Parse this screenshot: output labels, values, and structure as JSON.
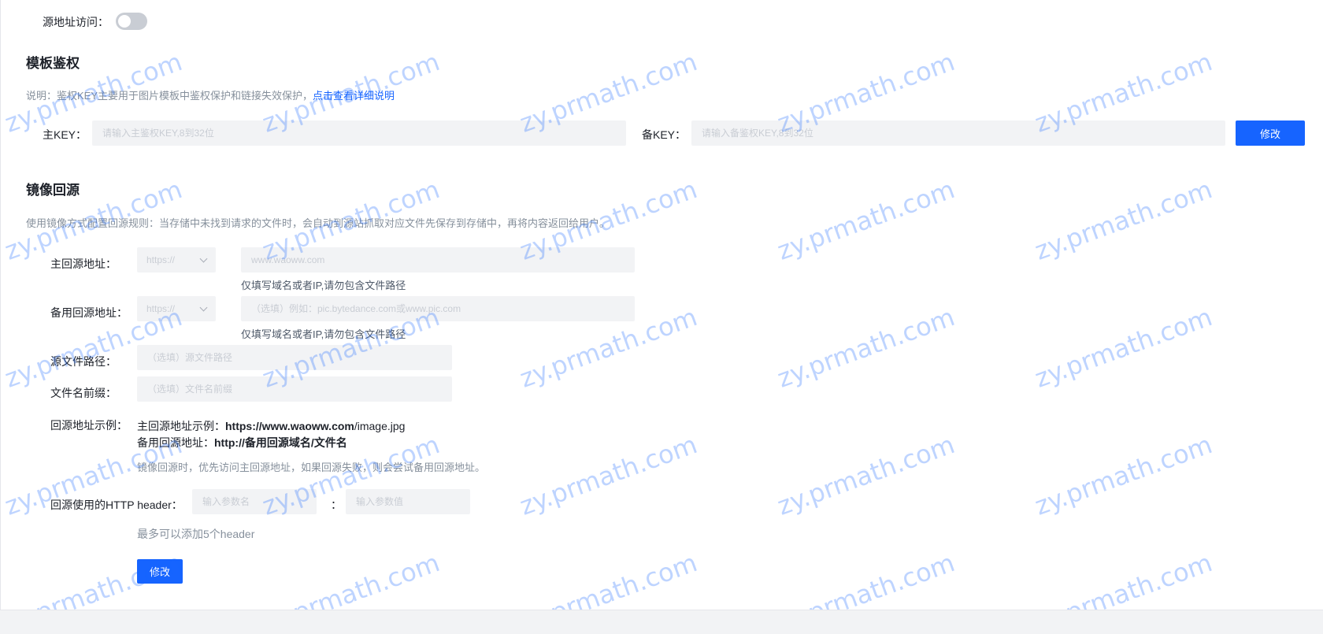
{
  "source_access": {
    "label": "源地址访问：",
    "enabled": false
  },
  "template_auth": {
    "title": "模板鉴权",
    "desc_prefix": "说明：鉴权KEY主要用于图片模板中鉴权保护和链接失效保护，",
    "desc_link": "点击查看详细说明",
    "main_key_label": "主KEY：",
    "main_key_placeholder": "请输入主鉴权KEY,8到32位",
    "backup_key_label": "备KEY：",
    "backup_key_placeholder": "请输入备鉴权KEY,8到32位",
    "save_label": "修改"
  },
  "mirror": {
    "title": "镜像回源",
    "desc": "使用镜像方式配置回源规则：当存储中未找到请求的文件时，会自动到源站抓取对应文件先保存到存储中，再将内容返回给用户。",
    "primary_label": "主回源地址：",
    "primary_protocol": "https://",
    "primary_placeholder": "www.waoww.com",
    "primary_hint": "仅填写域名或者IP,请勿包含文件路径",
    "backup_label": "备用回源地址：",
    "backup_protocol": "https://",
    "backup_placeholder": "（选填）例如：pic.bytedance.com或www.pic.com",
    "backup_hint": "仅填写域名或者IP,请勿包含文件路径",
    "path_label": "源文件路径：",
    "path_placeholder": "（选填）源文件路径",
    "prefix_label": "文件名前缀：",
    "prefix_placeholder": "（选填）文件名前缀",
    "example_label": "回源地址示例：",
    "example_primary_prefix": "主回源地址示例：",
    "example_primary_bold": "https://www.waoww.com",
    "example_primary_suffix": "/image.jpg",
    "example_backup_prefix": "备用回源地址：",
    "example_backup_bold": "http://备用回源域名/文件名",
    "example_note": "镜像回源时，优先访问主回源地址，如果回源失败，则会尝试备用回源地址。",
    "header_label": "回源使用的HTTP header：",
    "header_name_placeholder": "输入参数名",
    "header_sep": "：",
    "header_value_placeholder": "输入参数值",
    "header_hint": "最多可以添加5个header",
    "save_label": "修改"
  },
  "watermark_text": "zy.prmath.com"
}
